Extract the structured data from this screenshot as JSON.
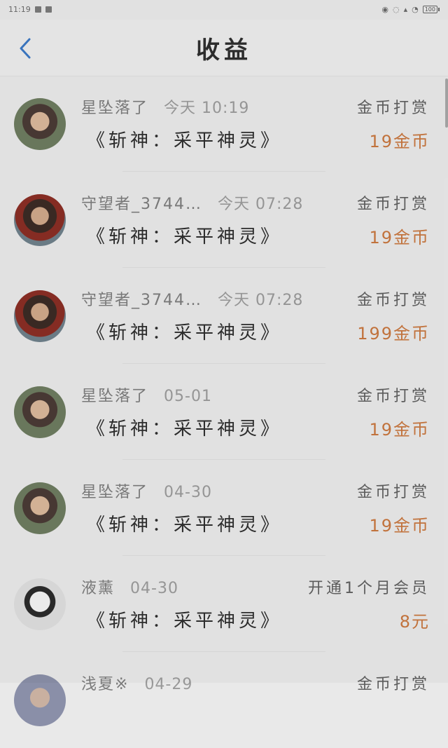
{
  "status_bar": {
    "time": "11:19",
    "battery": "100"
  },
  "header": {
    "title": "收益"
  },
  "items": [
    {
      "username": "星坠落了",
      "time": "今天 10:19",
      "book": "《斩神：采平神灵》",
      "type": "金币打赏",
      "amount": "19金币"
    },
    {
      "username": "守望者_3744…",
      "time": "今天 07:28",
      "book": "《斩神：采平神灵》",
      "type": "金币打赏",
      "amount": "19金币"
    },
    {
      "username": "守望者_3744…",
      "time": "今天 07:28",
      "book": "《斩神：采平神灵》",
      "type": "金币打赏",
      "amount": "199金币"
    },
    {
      "username": "星坠落了",
      "time": "05-01",
      "book": "《斩神：采平神灵》",
      "type": "金币打赏",
      "amount": "19金币"
    },
    {
      "username": "星坠落了",
      "time": "04-30",
      "book": "《斩神：采平神灵》",
      "type": "金币打赏",
      "amount": "19金币"
    },
    {
      "username": "液薰",
      "time": "04-30",
      "book": "《斩神：采平神灵》",
      "type": "开通1个月会员",
      "amount": "8元"
    },
    {
      "username": "浅夏※",
      "time": "04-29",
      "book": "",
      "type": "金币打赏",
      "amount": ""
    }
  ]
}
